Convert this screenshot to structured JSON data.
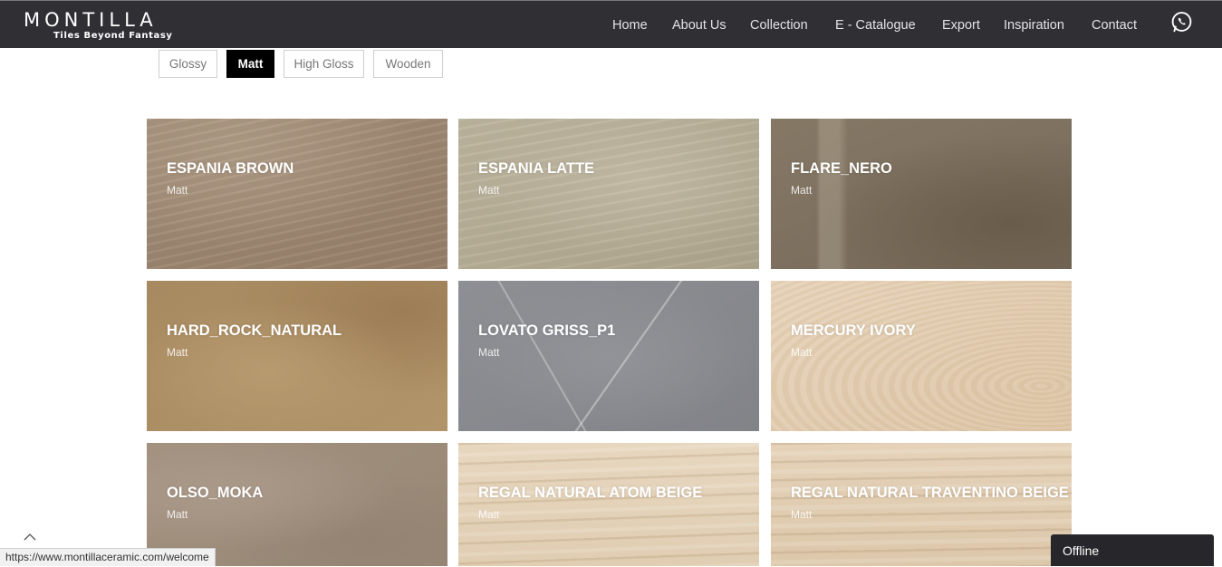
{
  "brand": {
    "name": "MONTILLA",
    "tagline": "Tiles Beyond Fantasy"
  },
  "nav": {
    "items": [
      {
        "label": "Home"
      },
      {
        "label": "About Us"
      },
      {
        "label": "Collection"
      },
      {
        "label": "E - Catalogue"
      },
      {
        "label": "Export"
      },
      {
        "label": "Inspiration"
      },
      {
        "label": "Contact"
      }
    ],
    "whatsapp_icon": "whatsapp-icon"
  },
  "filters": {
    "items": [
      {
        "label": "Glossy",
        "active": false
      },
      {
        "label": "Matt",
        "active": true
      },
      {
        "label": "High Gloss",
        "active": false
      },
      {
        "label": "Wooden",
        "active": false
      }
    ]
  },
  "products": [
    {
      "name": "ESPANIA BROWN",
      "finish": "Matt",
      "color": "#a08a73"
    },
    {
      "name": "ESPANIA LATTE",
      "finish": "Matt",
      "color": "#b9b19a"
    },
    {
      "name": "FLARE_NERO",
      "finish": "Matt",
      "color": "#7c6e5b"
    },
    {
      "name": "HARD_ROCK_NATURAL",
      "finish": "Matt",
      "color": "#ad8d63"
    },
    {
      "name": "LOVATO GRISS_P1",
      "finish": "Matt",
      "color": "#8b8c90"
    },
    {
      "name": "MERCURY IVORY",
      "finish": "Matt",
      "color": "#e2ccb0"
    },
    {
      "name": "OLSO_MOKA",
      "finish": "Matt",
      "color": "#9f8e7e"
    },
    {
      "name": "REGAL NATURAL ATOM BEIGE",
      "finish": "Matt",
      "color": "#e5d4bb"
    },
    {
      "name": "REGAL NATURAL TRAVENTINO BEIGE",
      "finish": "Matt",
      "color": "#e2cfb4"
    }
  ],
  "status": {
    "url": "https://www.montillaceramic.com/welcome"
  },
  "chat": {
    "label": "Offline"
  },
  "colors": {
    "navbar": "#2f2f34",
    "accent": "#000000"
  }
}
